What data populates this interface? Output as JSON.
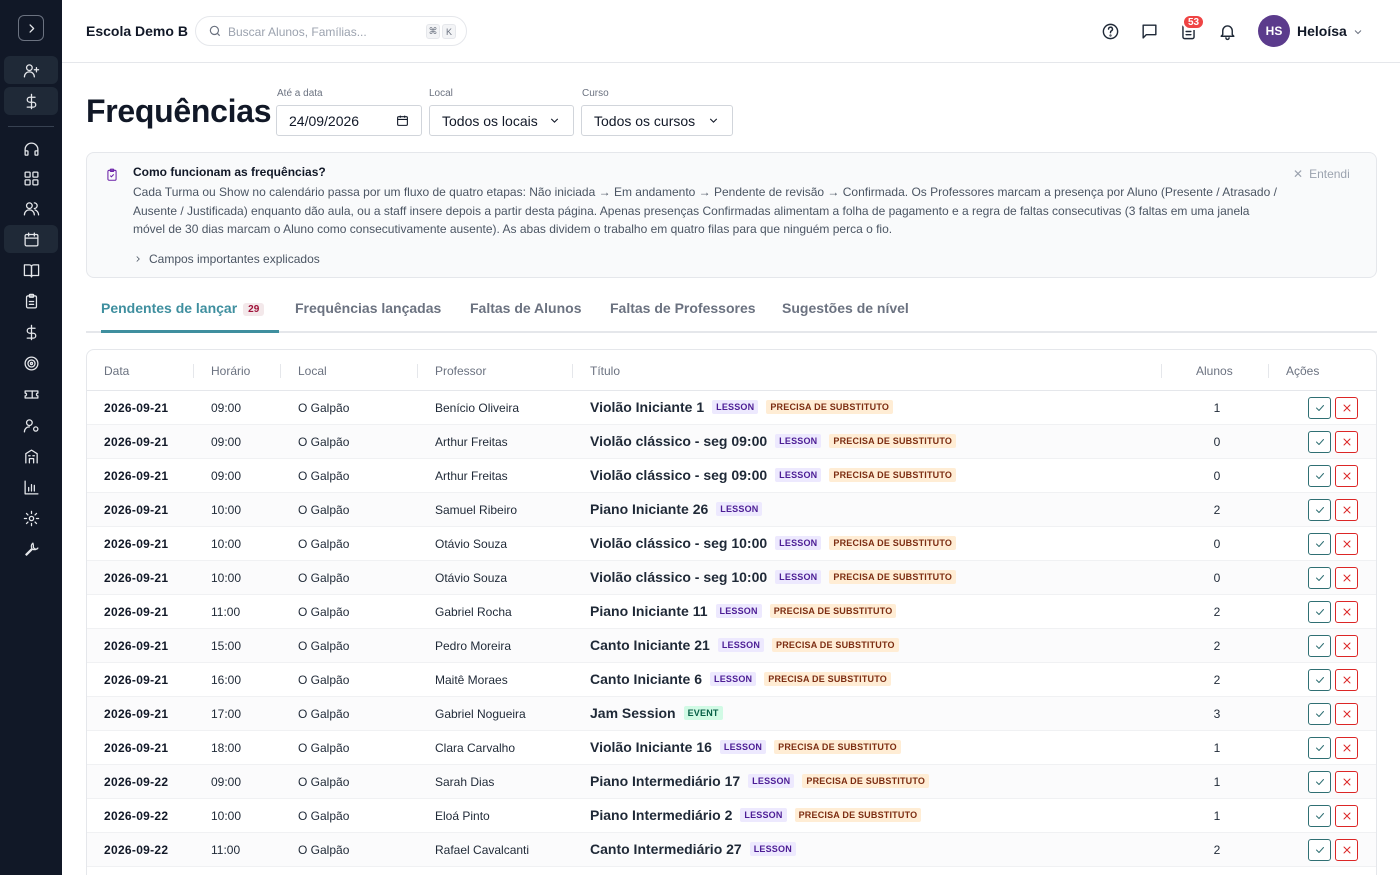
{
  "header": {
    "school_name": "Escola Demo B",
    "search_placeholder": "Buscar Alunos, Famílias...",
    "kbd_1": "⌘",
    "kbd_2": "K",
    "notification_count": "53",
    "user_initials": "HS",
    "user_name": "Heloísa"
  },
  "page": {
    "title": "Frequências"
  },
  "filters": {
    "date_label": "Até a data",
    "date_value": "24/09/2026",
    "location_label": "Local",
    "location_value": "Todos os locais",
    "course_label": "Curso",
    "course_value": "Todos os cursos"
  },
  "info": {
    "title": "Como funcionam as frequências?",
    "body": "Cada Turma ou Show no calendário passa por um fluxo de quatro etapas: Não iniciada → Em andamento → Pendente de revisão → Confirmada. Os Professores marcam a presença por Aluno (Presente / Atrasado / Ausente / Justificada) enquanto dão aula, ou a staff insere depois a partir desta página. Apenas presenças Confirmadas alimentam a folha de pagamento e a regra de faltas consecutivas (3 faltas em uma janela móvel de 30 dias marcam o Aluno como consecutivamente ausente). As abas dividem o trabalho em quatro filas para que ninguém perca o fio.",
    "dismiss": "Entendi",
    "expand": "Campos importantes explicados"
  },
  "tabs": [
    {
      "label": "Pendentes de lançar",
      "count": "29"
    },
    {
      "label": "Frequências lançadas"
    },
    {
      "label": "Faltas de Alunos"
    },
    {
      "label": "Faltas de Professores"
    },
    {
      "label": "Sugestões de nível"
    }
  ],
  "table": {
    "headers": [
      "Data",
      "Horário",
      "Local",
      "Professor",
      "Título",
      "Alunos",
      "Ações"
    ],
    "rows": [
      {
        "date": "2026-09-21",
        "time": "09:00",
        "location": "O Galpão",
        "teacher": "Benício Oliveira",
        "title": "Violão Iniciante 1",
        "tags": [
          "LESSON",
          "PRECISA DE SUBSTITUTO"
        ],
        "students": "1"
      },
      {
        "date": "2026-09-21",
        "time": "09:00",
        "location": "O Galpão",
        "teacher": "Arthur Freitas",
        "title": "Violão clássico - seg 09:00",
        "tags": [
          "LESSON",
          "PRECISA DE SUBSTITUTO"
        ],
        "students": "0"
      },
      {
        "date": "2026-09-21",
        "time": "09:00",
        "location": "O Galpão",
        "teacher": "Arthur Freitas",
        "title": "Violão clássico - seg 09:00",
        "tags": [
          "LESSON",
          "PRECISA DE SUBSTITUTO"
        ],
        "students": "0"
      },
      {
        "date": "2026-09-21",
        "time": "10:00",
        "location": "O Galpão",
        "teacher": "Samuel Ribeiro",
        "title": "Piano Iniciante 26",
        "tags": [
          "LESSON"
        ],
        "students": "2"
      },
      {
        "date": "2026-09-21",
        "time": "10:00",
        "location": "O Galpão",
        "teacher": "Otávio Souza",
        "title": "Violão clássico - seg 10:00",
        "tags": [
          "LESSON",
          "PRECISA DE SUBSTITUTO"
        ],
        "students": "0"
      },
      {
        "date": "2026-09-21",
        "time": "10:00",
        "location": "O Galpão",
        "teacher": "Otávio Souza",
        "title": "Violão clássico - seg 10:00",
        "tags": [
          "LESSON",
          "PRECISA DE SUBSTITUTO"
        ],
        "students": "0"
      },
      {
        "date": "2026-09-21",
        "time": "11:00",
        "location": "O Galpão",
        "teacher": "Gabriel Rocha",
        "title": "Piano Iniciante 11",
        "tags": [
          "LESSON",
          "PRECISA DE SUBSTITUTO"
        ],
        "students": "2"
      },
      {
        "date": "2026-09-21",
        "time": "15:00",
        "location": "O Galpão",
        "teacher": "Pedro Moreira",
        "title": "Canto Iniciante 21",
        "tags": [
          "LESSON",
          "PRECISA DE SUBSTITUTO"
        ],
        "students": "2"
      },
      {
        "date": "2026-09-21",
        "time": "16:00",
        "location": "O Galpão",
        "teacher": "Maitê Moraes",
        "title": "Canto Iniciante 6",
        "tags": [
          "LESSON",
          "PRECISA DE SUBSTITUTO"
        ],
        "students": "2"
      },
      {
        "date": "2026-09-21",
        "time": "17:00",
        "location": "O Galpão",
        "teacher": "Gabriel Nogueira",
        "title": "Jam Session",
        "tags": [
          "EVENT"
        ],
        "students": "3"
      },
      {
        "date": "2026-09-21",
        "time": "18:00",
        "location": "O Galpão",
        "teacher": "Clara Carvalho",
        "title": "Violão Iniciante 16",
        "tags": [
          "LESSON",
          "PRECISA DE SUBSTITUTO"
        ],
        "students": "1"
      },
      {
        "date": "2026-09-22",
        "time": "09:00",
        "location": "O Galpão",
        "teacher": "Sarah Dias",
        "title": "Piano Intermediário 17",
        "tags": [
          "LESSON",
          "PRECISA DE SUBSTITUTO"
        ],
        "students": "1"
      },
      {
        "date": "2026-09-22",
        "time": "10:00",
        "location": "O Galpão",
        "teacher": "Eloá Pinto",
        "title": "Piano Intermediário 2",
        "tags": [
          "LESSON",
          "PRECISA DE SUBSTITUTO"
        ],
        "students": "1"
      },
      {
        "date": "2026-09-22",
        "time": "11:00",
        "location": "O Galpão",
        "teacher": "Rafael Cavalcanti",
        "title": "Canto Intermediário 27",
        "tags": [
          "LESSON"
        ],
        "students": "2"
      }
    ]
  },
  "icons": {
    "sidebar": [
      "chevron-right-icon",
      "user-plus-icon",
      "dollar-icon",
      "headset-icon",
      "grid-icon",
      "users-icon",
      "calendar-icon",
      "book-icon",
      "clipboard-icon",
      "dollar-icon",
      "target-icon",
      "ticket-icon",
      "user-gear-icon",
      "building-icon",
      "chart-icon",
      "gear-icon",
      "wrench-icon"
    ]
  }
}
